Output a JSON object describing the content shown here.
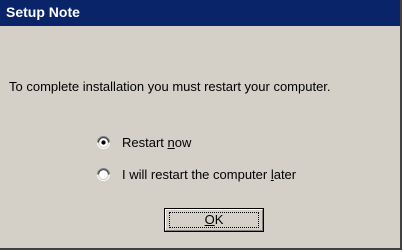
{
  "dialog": {
    "title": "Setup Note",
    "message": "To complete installation you must restart your computer."
  },
  "options": [
    {
      "prefix": "Restart ",
      "accel": "n",
      "suffix": "ow",
      "selected": true
    },
    {
      "prefix": "I will restart the computer ",
      "accel": "l",
      "suffix": "ater",
      "selected": false
    }
  ],
  "ok_button": {
    "label_accel": "O",
    "label_rest": "K"
  },
  "colors": {
    "title_bar": "#0a246a",
    "dialog_face": "#d4d0c8"
  },
  "icons": [
    "radio-selected-icon",
    "radio-unselected-icon"
  ]
}
